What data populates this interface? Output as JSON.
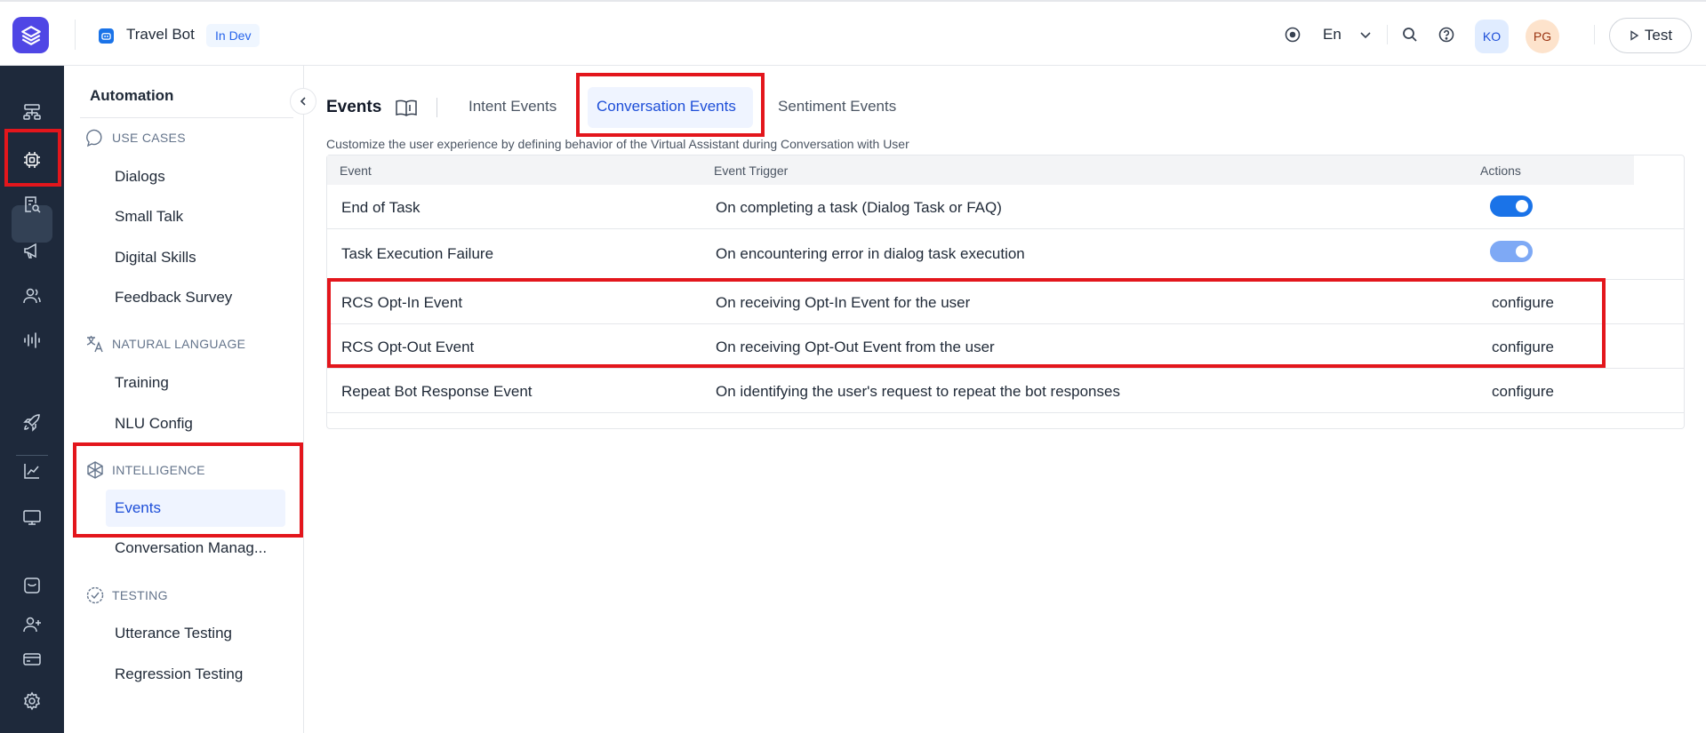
{
  "header": {
    "bot_name": "Travel Bot",
    "bot_status": "In Dev",
    "language": "En",
    "avatars": [
      "KO",
      "PG"
    ],
    "test_label": "Test",
    "colors": {
      "brand": "#4f46e5",
      "accent": "#1d4ed8"
    }
  },
  "rail": {
    "icons": [
      "flow-icon",
      "automation-icon",
      "search-doc-icon",
      "megaphone-icon",
      "users-icon",
      "voice-icon",
      "rocket-icon",
      "analytics-icon",
      "monitor-icon",
      "inbox-icon",
      "add-user-icon",
      "billing-icon",
      "settings-icon"
    ],
    "active": "automation-icon"
  },
  "sidebar": {
    "title": "Automation",
    "sections": [
      {
        "label": "USE CASES",
        "items": [
          "Dialogs",
          "Small Talk",
          "Digital Skills",
          "Feedback Survey"
        ]
      },
      {
        "label": "NATURAL LANGUAGE",
        "items": [
          "Training",
          "NLU Config"
        ]
      },
      {
        "label": "INTELLIGENCE",
        "items": [
          "Events",
          "Conversation Manag..."
        ]
      },
      {
        "label": "TESTING",
        "items": [
          "Utterance Testing",
          "Regression Testing"
        ]
      }
    ],
    "active_item": "Events"
  },
  "main": {
    "title": "Events",
    "tabs": [
      {
        "label": "Intent Events",
        "active": false
      },
      {
        "label": "Conversation Events",
        "active": true
      },
      {
        "label": "Sentiment Events",
        "active": false
      }
    ],
    "description": "Customize the user experience by defining behavior of the Virtual Assistant during Conversation with User",
    "table": {
      "columns": [
        "Event",
        "Event Trigger",
        "Actions"
      ],
      "rows": [
        {
          "event": "End of Task",
          "trigger": "On completing a task (Dialog Task or FAQ)",
          "action": "toggle-on"
        },
        {
          "event": "Task Execution Failure",
          "trigger": "On encountering error in dialog task execution",
          "action": "toggle-on-disabled"
        },
        {
          "event": "RCS Opt-In Event",
          "trigger": "On receiving Opt-In Event for the user",
          "action": "configure"
        },
        {
          "event": "RCS Opt-Out Event",
          "trigger": "On receiving Opt-Out Event from the user",
          "action": "configure"
        },
        {
          "event": "Repeat Bot Response Event",
          "trigger": "On identifying the user's request to repeat the bot responses",
          "action": "configure"
        }
      ]
    }
  }
}
